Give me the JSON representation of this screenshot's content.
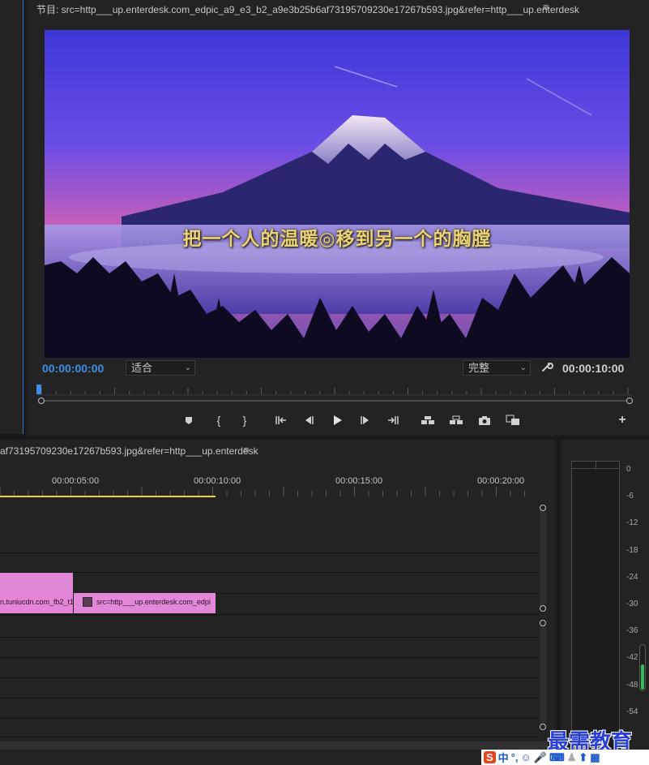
{
  "program": {
    "title": "节目: src=http___up.enterdesk.com_edpic_a9_e3_b2_a9e3b25b6af73195709230e17267b593.jpg&refer=http___up.enterdesk",
    "menu_icon": "≡",
    "caption": "把一个人的温暖◎移到另一个的胸膛",
    "timecode_left": "00:00:00:00",
    "fit": "适合",
    "quality": "完整",
    "timecode_right": "00:00:10:00",
    "playhead_fraction": 0.0
  },
  "transport": {
    "buttons": [
      "marker-icon",
      "mark-in-icon",
      "mark-out-icon",
      "go-to-in-icon",
      "step-back-icon",
      "play-icon",
      "step-forward-icon",
      "go-to-out-icon",
      "lift-icon",
      "extract-icon",
      "export-frame-icon",
      "compare-icon",
      "add-button-icon"
    ],
    "add_label": "+"
  },
  "timeline": {
    "title": "af73195709230e17267b593.jpg&refer=http___up.enterdesk",
    "menu_icon": "≡",
    "ticks": [
      "00:00:05:00",
      "00:00:10:00",
      "00:00:15:00",
      "00:00:20:00"
    ],
    "clips": [
      {
        "label": "n.tuniucdn.com_fb2_t1",
        "color": "#e086d6"
      },
      {
        "label": "src=http___up.enterdesk.com_edpi",
        "color": "#e388d9"
      }
    ]
  },
  "meter": {
    "db_labels": [
      "0",
      "-6",
      "-12",
      "-18",
      "-24",
      "-30",
      "-36",
      "-42",
      "-48",
      "-54"
    ],
    "level_fraction": 0.5
  },
  "watermark": "最需教育",
  "ime": {
    "s_logo": "S",
    "lang": "中",
    "punct": "°,"
  },
  "colors": {
    "accent": "#3d8fe6",
    "work_area": "#e9d43b",
    "clip_pink": "#e086d6",
    "meter_green": "#2fbf5a"
  }
}
